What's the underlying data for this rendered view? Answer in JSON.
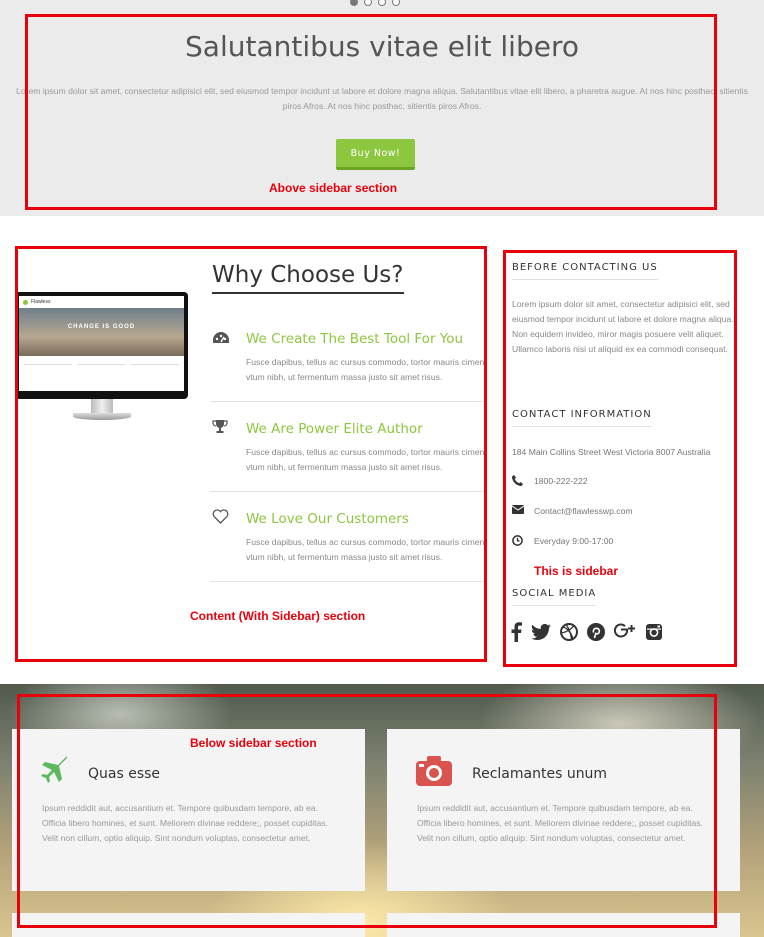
{
  "hero": {
    "title": "Salutantibus vitae elit libero",
    "text": "Lorem ipsum dolor sit amet, consectetur adipisici elit, sed eiusmod tempor incidunt ut labore et dolore magna aliqua. Salutantibus vitae elit libero, a pharetra augue. At nos hinc posthac, sitientis piros Afros. At nos hinc posthac, sitientis piros Afros.",
    "button": "Buy Now!",
    "annotation": "Above sidebar section",
    "slider_dots": 4,
    "active_dot": 1
  },
  "content": {
    "title": "Why Choose Us?",
    "monitor": {
      "brand": "Flawless",
      "banner": "CHANGE    IS GOOD"
    },
    "features": [
      {
        "icon": "dashboard-icon",
        "title": "We Create The Best Tool For You",
        "text": "Fusce dapibus, tellus ac cursus commodo, tortor mauris cimen vtum nibh, ut fermentum massa justo sit amet risus."
      },
      {
        "icon": "trophy-icon",
        "title": "We Are Power Elite Author",
        "text": "Fusce dapibus, tellus ac cursus commodo, tortor mauris cimen vtum nibh, ut fermentum massa justo sit amet risus."
      },
      {
        "icon": "heart-icon",
        "title": "We Love Our Customers",
        "text": "Fusce dapibus, tellus ac cursus commodo, tortor mauris cimen vtum nibh, ut fermentum massa justo sit amet risus."
      }
    ],
    "annotation": "Content (With Sidebar) section"
  },
  "sidebar": {
    "before_heading": "BEFORE CONTACTING US",
    "before_text": "Lorem ipsum dolor sit amet, consectetur adipisici elit, sed eiusmod tempor incidunt ut labore et dolore magna aliqua. Non equidem invideo, miror magis posuere velit aliquet. Ullamco laboris nisi ut aliquid ex ea commodi consequat.",
    "contact_heading": "CONTACT INFORMATION",
    "address": "184 Main Collins Street West Victoria 8007 Australia",
    "phone": "1800-222-222",
    "email": "Contact@flawlesswp.com",
    "hours": "Everyday 9:00-17:00",
    "annotation": "This is sidebar",
    "social_heading": "SOCIAL MEDIA",
    "social_icons": [
      "facebook-icon",
      "twitter-icon",
      "dribbble-icon",
      "pinterest-icon",
      "google-plus-icon",
      "instagram-icon"
    ]
  },
  "below": {
    "annotation": "Below sidebar section",
    "cards": [
      {
        "icon": "plane-icon",
        "title": "Quas esse",
        "text": "Ipsum reddidit aut, accusantium et. Tempore quibusdam tempore, ab ea. Officia libero homines, et sunt. Meliorem divinae reddere;, posset cupiditas. Velit non cillum, optio aliquip. Sint nondum voluptas, consectetur amet."
      },
      {
        "icon": "camera-icon",
        "title": "Reclamantes unum",
        "text": "Ipsum reddidit aut, accusantium et. Tempore quibusdam tempore, ab ea. Officia libero homines, et sunt. Meliorem divinae reddere;, posset cupiditas. Velit non cillum, optio aliquip. Sint nondum voluptas, consectetur amet."
      }
    ]
  },
  "colors": {
    "accent_green": "#8dc63f",
    "annotation_red": "#e8000b",
    "camera_red": "#d9534f"
  }
}
